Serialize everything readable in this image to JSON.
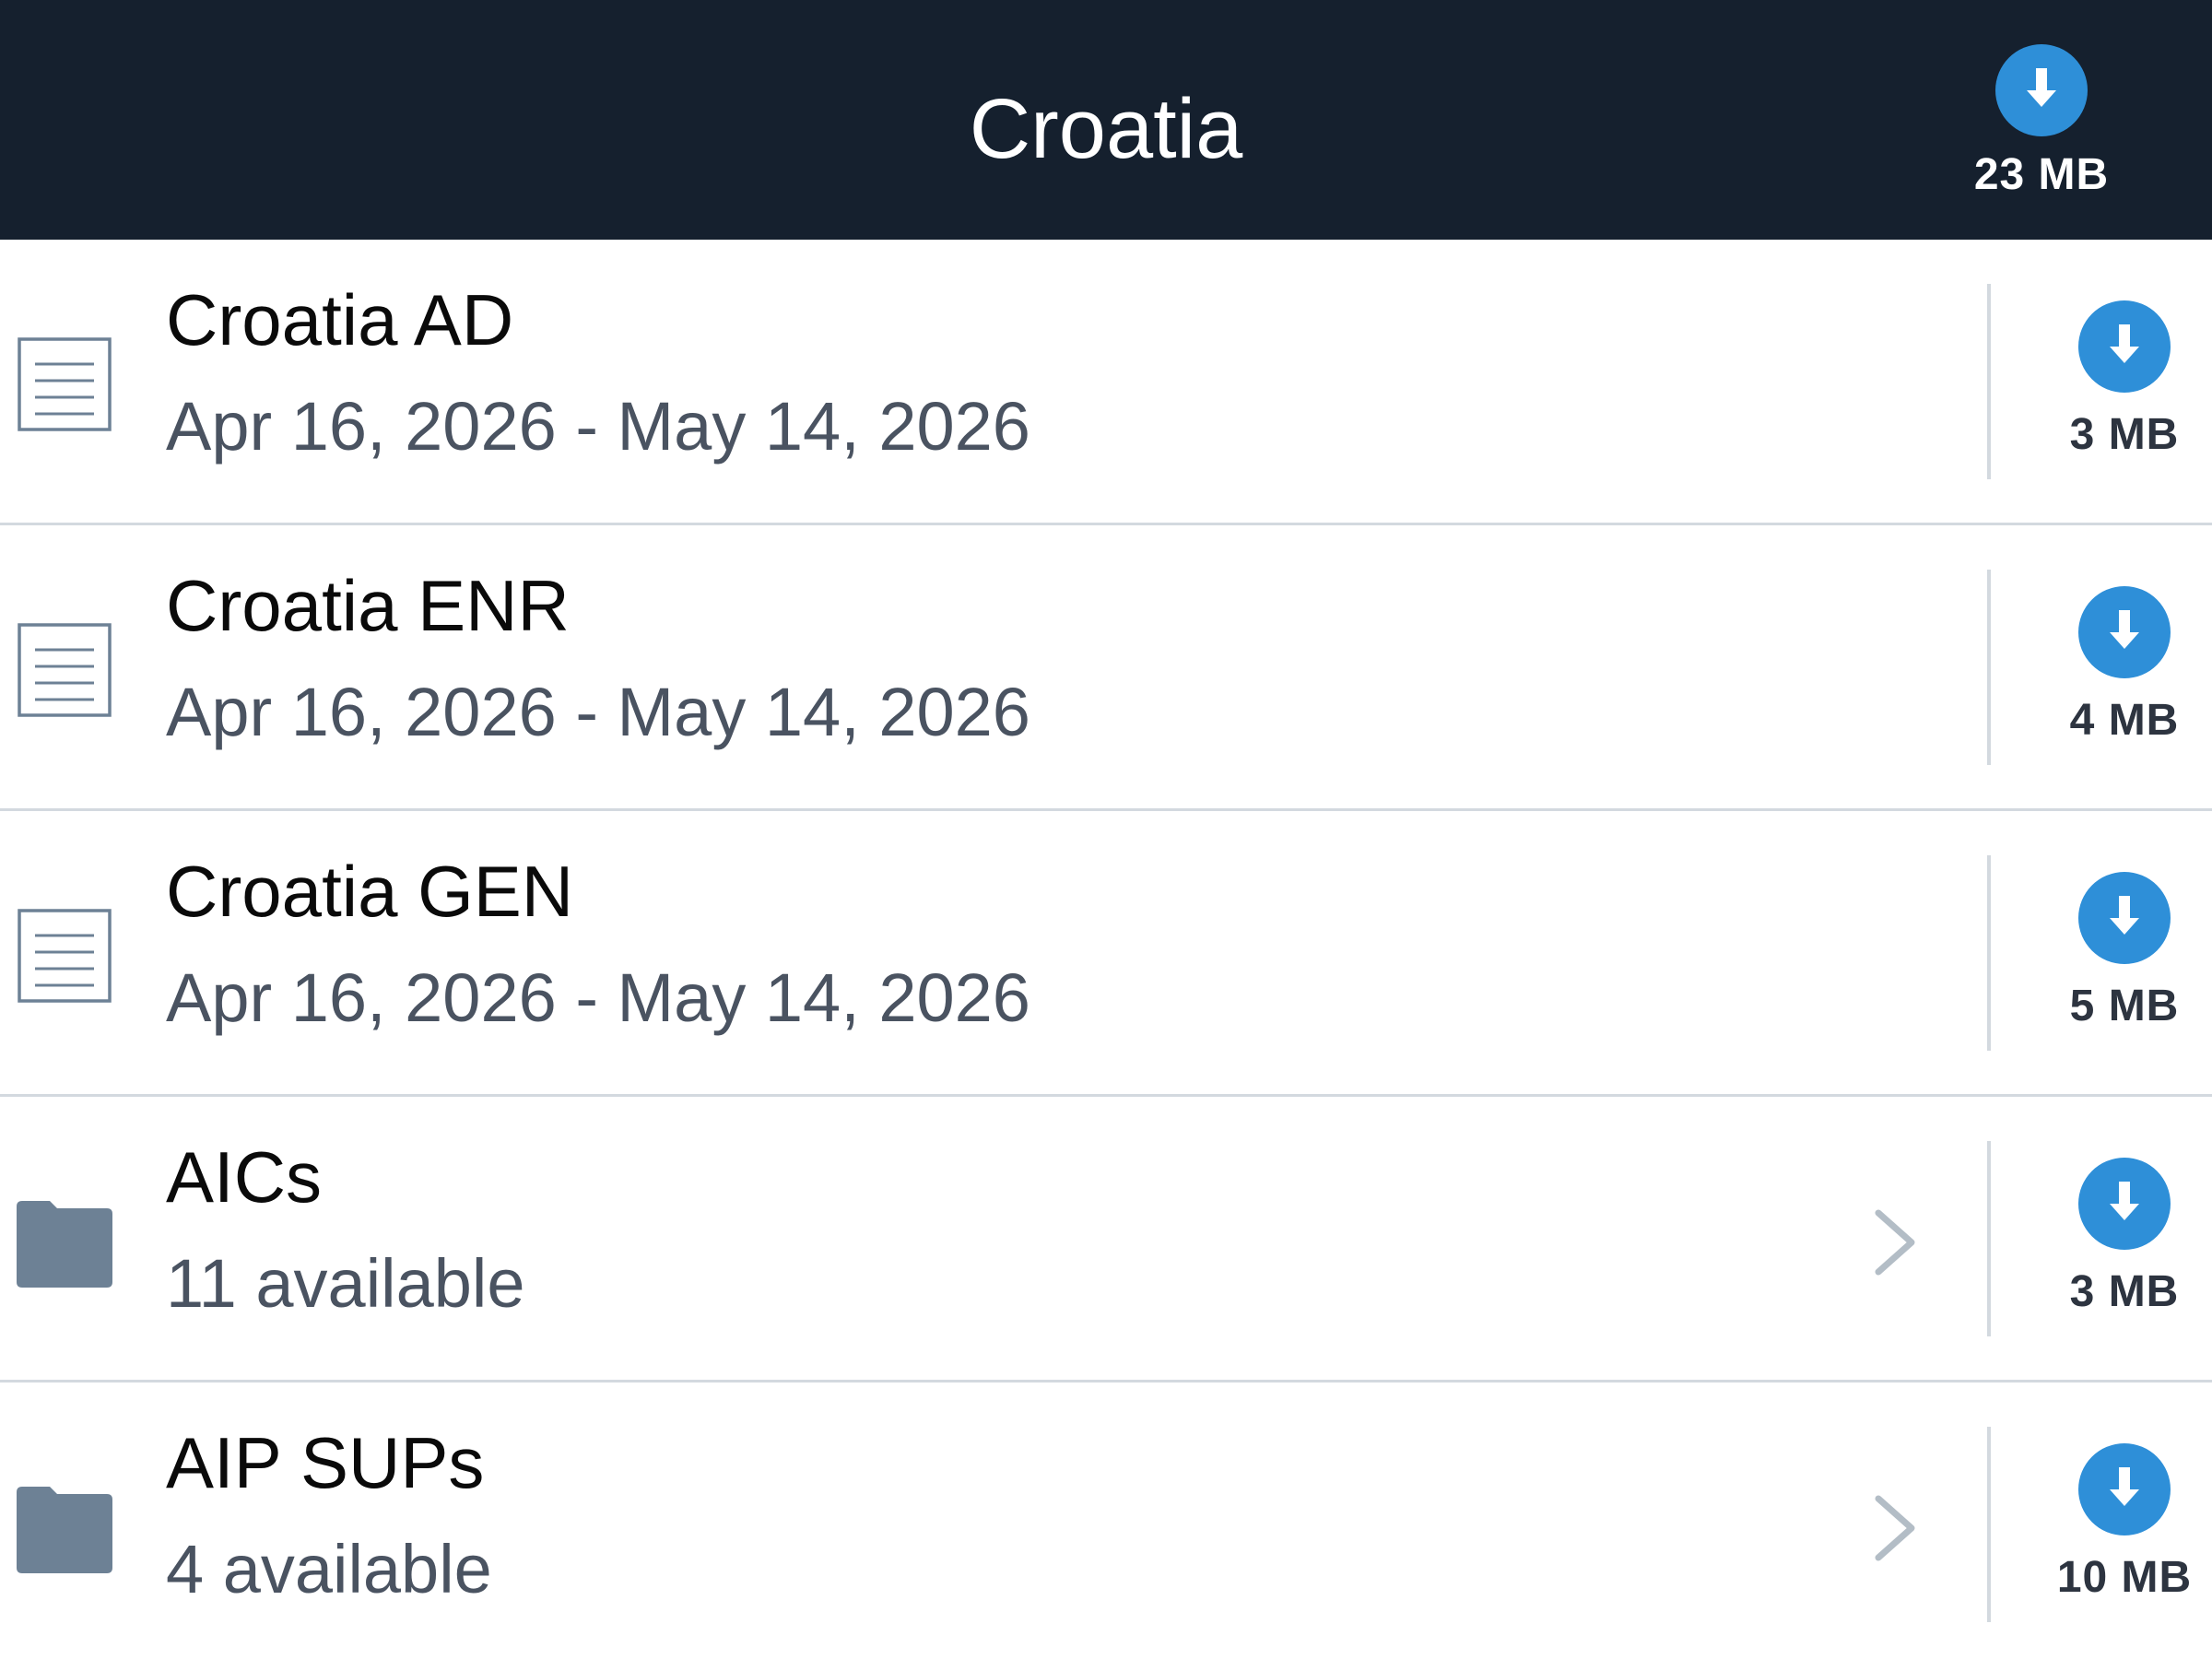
{
  "header": {
    "title": "Croatia",
    "download_size": "23 MB",
    "download_icon": "download-arrow-icon"
  },
  "colors": {
    "header_bg": "#15202e",
    "accent": "#2e8fd8",
    "divider": "#d3d9df",
    "folder": "#6d8195",
    "doc_icon": "#6d8195"
  },
  "items": [
    {
      "type": "document",
      "icon": "document-icon",
      "title": "Croatia AD",
      "subtitle": "Apr 16, 2026 - May 14, 2026",
      "size": "3 MB",
      "has_chevron": false
    },
    {
      "type": "document",
      "icon": "document-icon",
      "title": "Croatia ENR",
      "subtitle": "Apr 16, 2026 - May 14, 2026",
      "size": "4 MB",
      "has_chevron": false
    },
    {
      "type": "document",
      "icon": "document-icon",
      "title": "Croatia GEN",
      "subtitle": "Apr 16, 2026 - May 14, 2026",
      "size": "5 MB",
      "has_chevron": false
    },
    {
      "type": "folder",
      "icon": "folder-icon",
      "title": "AICs",
      "subtitle": "11 available",
      "size": "3 MB",
      "has_chevron": true
    },
    {
      "type": "folder",
      "icon": "folder-icon",
      "title": "AIP SUPs",
      "subtitle": "4 available",
      "size": "10 MB",
      "has_chevron": true
    }
  ]
}
